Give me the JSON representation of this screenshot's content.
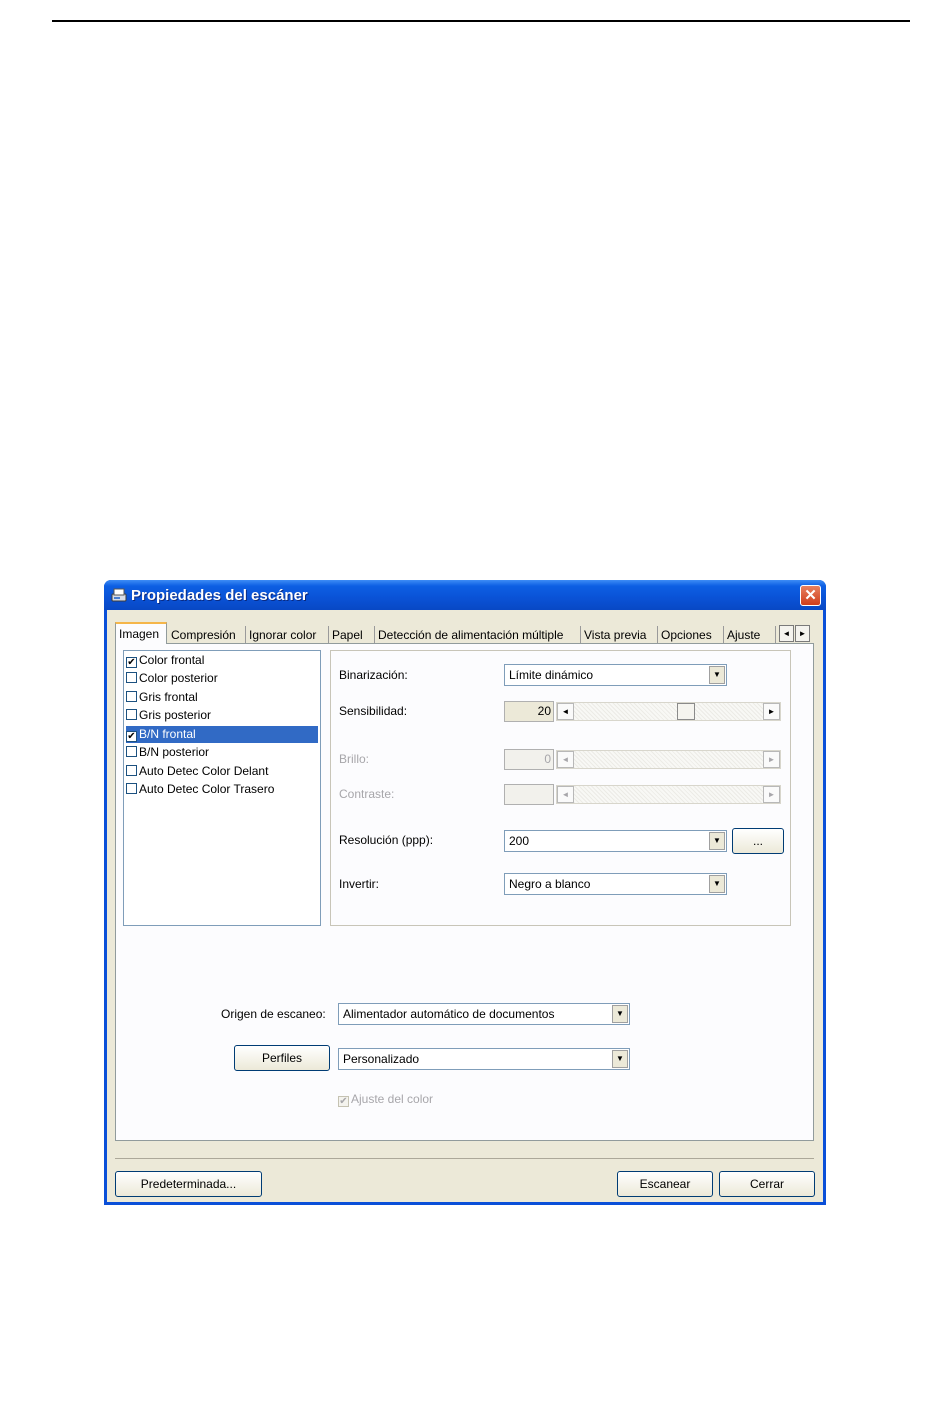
{
  "window": {
    "title": "Propiedades del escáner",
    "close_symbol": "✕"
  },
  "tabs": [
    {
      "label": "Imagen",
      "active": true
    },
    {
      "label": "Compresión"
    },
    {
      "label": "Ignorar color"
    },
    {
      "label": "Papel"
    },
    {
      "label": "Detección de alimentación múltiple"
    },
    {
      "label": "Vista previa"
    },
    {
      "label": "Opciones"
    },
    {
      "label": "Ajuste"
    }
  ],
  "tab_scroll": {
    "left": "◄",
    "right": "►"
  },
  "image_types": [
    {
      "label": "Color frontal",
      "checked": true,
      "selected": false
    },
    {
      "label": "Color posterior",
      "checked": false,
      "selected": false
    },
    {
      "label": "Gris frontal",
      "checked": false,
      "selected": false
    },
    {
      "label": "Gris posterior",
      "checked": false,
      "selected": false
    },
    {
      "label": "B/N frontal",
      "checked": true,
      "selected": true
    },
    {
      "label": "B/N posterior",
      "checked": false,
      "selected": false
    },
    {
      "label": "Auto Detec Color Delant",
      "checked": false,
      "selected": false
    },
    {
      "label": "Auto Detec Color Trasero",
      "checked": false,
      "selected": false
    }
  ],
  "settings": {
    "binarization_label": "Binarización:",
    "binarization_value": "Límite dinámico",
    "sensitivity_label": "Sensibilidad:",
    "sensitivity_value": "20",
    "brightness_label": "Brillo:",
    "brightness_value": "0",
    "contrast_label": "Contraste:",
    "contrast_value": "",
    "resolution_label": "Resolución (ppp):",
    "resolution_value": "200",
    "resolution_more": "...",
    "invert_label": "Invertir:",
    "invert_value": "Negro a blanco"
  },
  "sliders": {
    "sensitivity_level": 0.6
  },
  "scan_source_label": "Origen de escaneo:",
  "scan_source_value": "Alimentador automático de documentos",
  "profiles_button": "Perfiles",
  "profiles_value": "Personalizado",
  "color_adjust_label": "Ajuste del color",
  "color_adjust_checked": true,
  "buttons": {
    "default": "Predeterminada...",
    "scan": "Escanear",
    "close": "Cerrar"
  },
  "combo_arrow": "▼",
  "check_mark": "✔"
}
